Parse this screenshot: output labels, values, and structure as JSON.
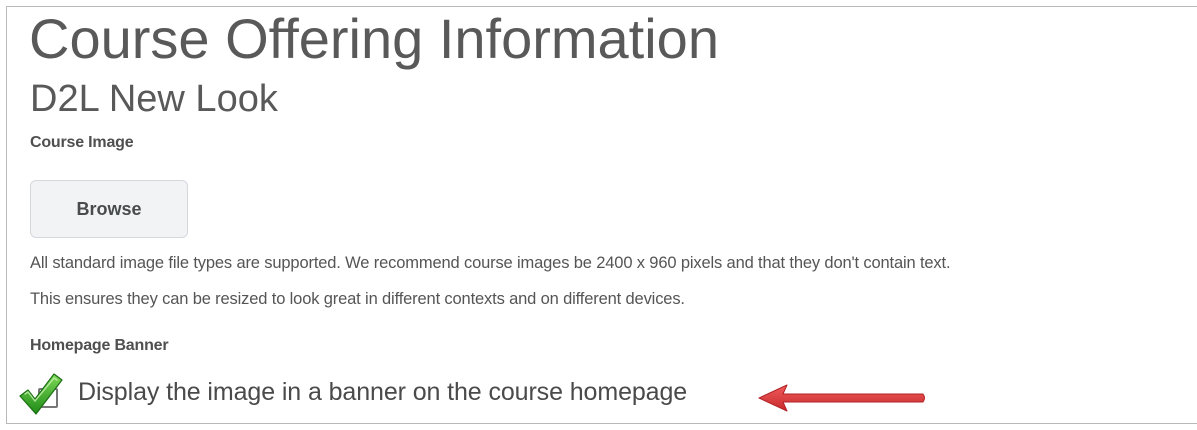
{
  "page": {
    "title": "Course Offering Information",
    "subtitle": "D2L New Look"
  },
  "course_image": {
    "label": "Course Image",
    "browse_button": "Browse",
    "help_line1": "All standard image file types are supported. We recommend course images be 2400 x 960 pixels and that they don't contain text.",
    "help_line2": "This ensures they can be resized to look great in different contexts and on different devices."
  },
  "homepage_banner": {
    "label": "Homepage Banner",
    "checkbox_label": "Display the image in a banner on the course homepage",
    "checked": true
  },
  "annotations": {
    "check_icon": "green-check-icon",
    "arrow_icon": "red-arrow-icon",
    "check_color": "#2e9e1f",
    "arrow_color": "#d9383a"
  }
}
